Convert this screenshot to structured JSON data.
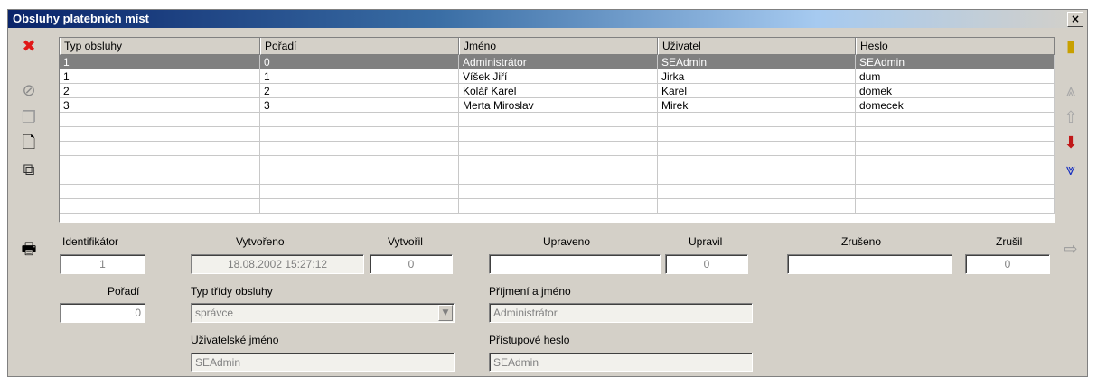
{
  "window": {
    "title": "Obsluhy platebních míst",
    "close_label": "×"
  },
  "grid": {
    "columns": [
      "Typ obsluhy",
      "Pořadí",
      "Jméno",
      "Uživatel",
      "Heslo"
    ],
    "rows": [
      [
        "1",
        "0",
        "Administrátor",
        "SEAdmin",
        "SEAdmin"
      ],
      [
        "1",
        "1",
        "Víšek Jiří",
        "Jirka",
        "dum"
      ],
      [
        "2",
        "2",
        "Kolář Karel",
        "Karel",
        "domek"
      ],
      [
        "3",
        "3",
        "Merta Miroslav",
        "Mirek",
        "domecek"
      ]
    ]
  },
  "toolbar_left": [
    {
      "icon": "delete-icon",
      "glyph": "✖",
      "color": "#e01818"
    },
    {
      "icon": "cancel-icon",
      "glyph": "⊘",
      "color": "#8a8a8a"
    },
    {
      "icon": "copy-icon",
      "glyph": "❐",
      "color": "#9a9a9a"
    },
    {
      "icon": "new-icon",
      "glyph": "🗋",
      "color": "#000000"
    },
    {
      "icon": "duplicate-icon",
      "glyph": "⧉",
      "color": "#303030"
    },
    {
      "icon": "print-icon",
      "glyph": "🖶",
      "color": "#000000"
    }
  ],
  "toolbar_right": [
    {
      "icon": "exit-icon",
      "glyph": "▮",
      "color": "#c8a000"
    },
    {
      "icon": "first-icon",
      "glyph": "⩓",
      "color": "#a8a8a8"
    },
    {
      "icon": "up-icon",
      "glyph": "⇧",
      "color": "#a8a8a8"
    },
    {
      "icon": "down-icon",
      "glyph": "⬇",
      "color": "#c01818"
    },
    {
      "icon": "last-icon",
      "glyph": "⩔",
      "color": "#1830c0"
    },
    {
      "icon": "goto-icon",
      "glyph": "⇨",
      "color": "#9a9a9a"
    }
  ],
  "form": {
    "identifikator_label": "Identifikátor",
    "identifikator_value": "1",
    "vytvoreno_label": "Vytvořeno",
    "vytvoreno_value": "18.08.2002 15:27:12",
    "vytvoril_label": "Vytvořil",
    "vytvoril_value": "0",
    "upraveno_label": "Upraveno",
    "upraveno_value": "",
    "upravil_label": "Upravil",
    "upravil_value": "0",
    "zruseno_label": "Zrušeno",
    "zruseno_value": "",
    "zrusil_label": "Zrušil",
    "zrusil_value": "0",
    "poradi_label": "Pořadí",
    "poradi_value": "0",
    "typ_label": "Typ třídy obsluhy",
    "typ_value": "správce",
    "prijmeni_label": "Příjmení a jméno",
    "prijmeni_value": "Administrátor",
    "uzivatel_label": "Uživatelské jméno",
    "uzivatel_value": "SEAdmin",
    "heslo_label": "Přístupové heslo",
    "heslo_value": "SEAdmin"
  }
}
